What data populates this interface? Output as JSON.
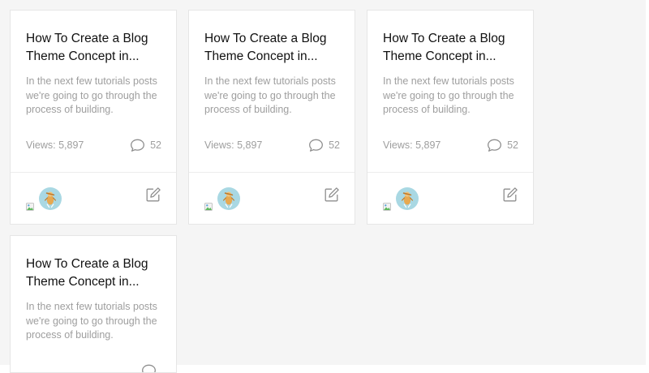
{
  "posts": [
    {
      "title": "How To Create a Blog Theme Concept in...",
      "excerpt": "In the next few tutorials posts we're going to go through the process of building.",
      "views": "Views: 5,897",
      "comments": "52"
    },
    {
      "title": "How To Create a Blog Theme Concept in...",
      "excerpt": "In the next few tutorials posts we're going to go through the process of building.",
      "views": "Views: 5,897",
      "comments": "52"
    },
    {
      "title": "How To Create a Blog Theme Concept in...",
      "excerpt": "In the next few tutorials posts we're going to go through the process of building.",
      "views": "Views: 5,897",
      "comments": "52"
    },
    {
      "title": "How To Create a Blog Theme Concept in...",
      "excerpt": "In the next few tutorials posts we're going to go through the process of building."
    }
  ],
  "icons": {
    "comment": "comment-icon",
    "edit": "edit-icon",
    "broken_image": "broken-image-icon",
    "avatar": "avatar-image"
  },
  "colors": {
    "background": "#f5f5f5",
    "card": "#ffffff",
    "title": "#111111",
    "muted": "#9e9e9e",
    "avatar_bg": "#a9d8e3"
  }
}
